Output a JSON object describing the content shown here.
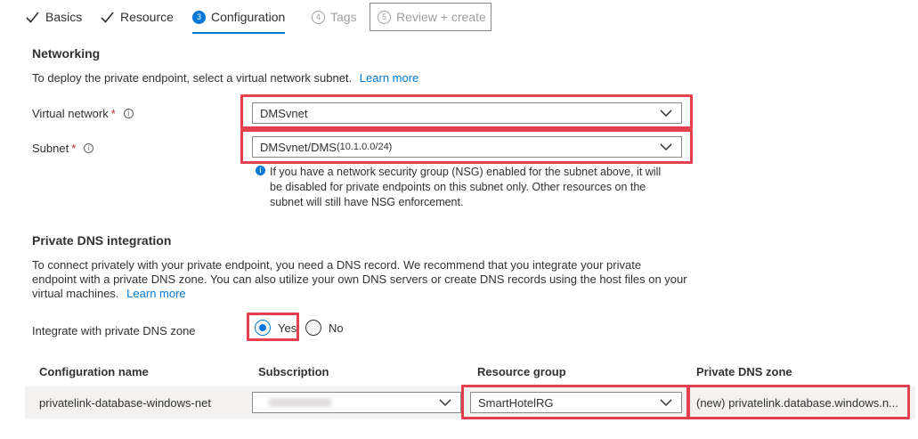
{
  "tabs": {
    "basics": "Basics",
    "resource": "Resource",
    "configuration_num": "3",
    "configuration": "Configuration",
    "tags_num": "4",
    "tags": "Tags",
    "review_num": "5",
    "review": "Review + create"
  },
  "networking": {
    "title": "Networking",
    "description": "To deploy the private endpoint, select a virtual network subnet.",
    "learn_more": "Learn more",
    "virtual_network_label": "Virtual network",
    "subnet_label": "Subnet",
    "required_mark": "*",
    "info_glyph": "i",
    "virtual_network_value": "DMSvnet",
    "subnet_value": "DMSvnet/DMS",
    "subnet_range": "(10.1.0.0/24)",
    "nsg_message_line1": "If you have a network security group (NSG) enabled for the subnet above, it will",
    "nsg_message_line2": "be disabled for private endpoints on this subnet only. Other resources on the",
    "nsg_message_line3": "subnet will still have NSG enforcement."
  },
  "dns": {
    "title": "Private DNS integration",
    "description_line1": "To connect privately with your private endpoint, you need a DNS record. We recommend that you integrate your private",
    "description_line2": "endpoint with a private DNS zone. You can also utilize your own DNS servers or create DNS records using the host files on your",
    "description_line3": "virtual machines.",
    "learn_more": "Learn more",
    "integrate_label": "Integrate with private DNS zone",
    "yes_label": "Yes",
    "no_label": "No",
    "selected": "Yes"
  },
  "table": {
    "headers": {
      "config_name": "Configuration name",
      "subscription": "Subscription",
      "resource_group": "Resource group",
      "private_dns_zone": "Private DNS zone"
    },
    "row": {
      "config_name": "privatelink-database-windows-net",
      "resource_group": "SmartHotelRG",
      "private_dns_zone": "(new) privatelink.database.windows.n..."
    }
  },
  "colors": {
    "accent": "#0078d4",
    "highlight": "#e5404e",
    "required": "#a4262c"
  },
  "icons": {
    "completed": "check-icon",
    "dropdown": "chevron-down-icon",
    "info": "info-icon"
  }
}
